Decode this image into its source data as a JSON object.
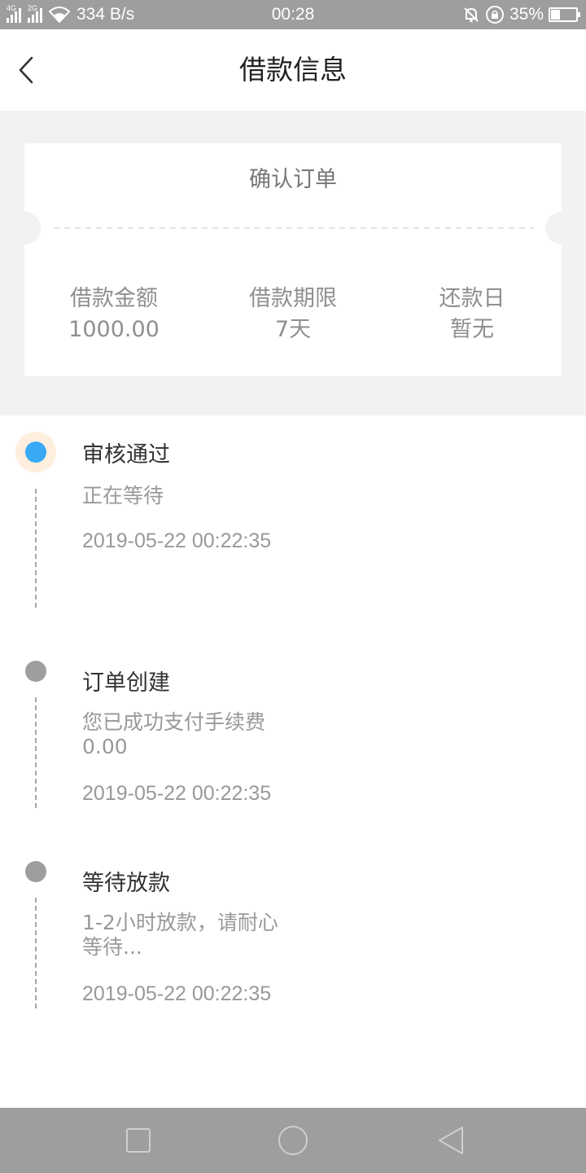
{
  "status_bar": {
    "network_left": "4G",
    "network_right": "2G",
    "speed": "334 B/s",
    "time": "00:28",
    "battery": "35%",
    "battery_level": 0.35,
    "icons": [
      "signal-icon",
      "wifi-icon",
      "mute-icon",
      "rotation-lock-icon",
      "battery-icon"
    ]
  },
  "header": {
    "title": "借款信息",
    "back_icon": "chevron-left-icon"
  },
  "ticket": {
    "title": "确认订单",
    "columns": [
      {
        "label": "借款金额",
        "value": "1000.00"
      },
      {
        "label": "借款期限",
        "value": "7天"
      },
      {
        "label": "还款日",
        "value": "暂无"
      }
    ]
  },
  "timeline": [
    {
      "title": "审核通过",
      "desc": "正在等待",
      "time": "2019-05-22 00:22:35",
      "active": true
    },
    {
      "title": "订单创建",
      "desc": "您已成功支付手续费0.00",
      "time": "2019-05-22 00:22:35",
      "active": false
    },
    {
      "title": "等待放款",
      "desc": "1-2小时放款，请耐心等待...",
      "time": "2019-05-22 00:22:35",
      "active": false
    }
  ],
  "colors": {
    "active_dot": "#39a9f5",
    "active_halo": "#fdeede",
    "inactive_dot": "#9e9e9e",
    "bar_gray": "#9e9e9e",
    "background_gray": "#f2f2f2"
  },
  "nav_bar": {
    "icons": [
      "square-icon",
      "circle-icon",
      "triangle-back-icon"
    ]
  }
}
